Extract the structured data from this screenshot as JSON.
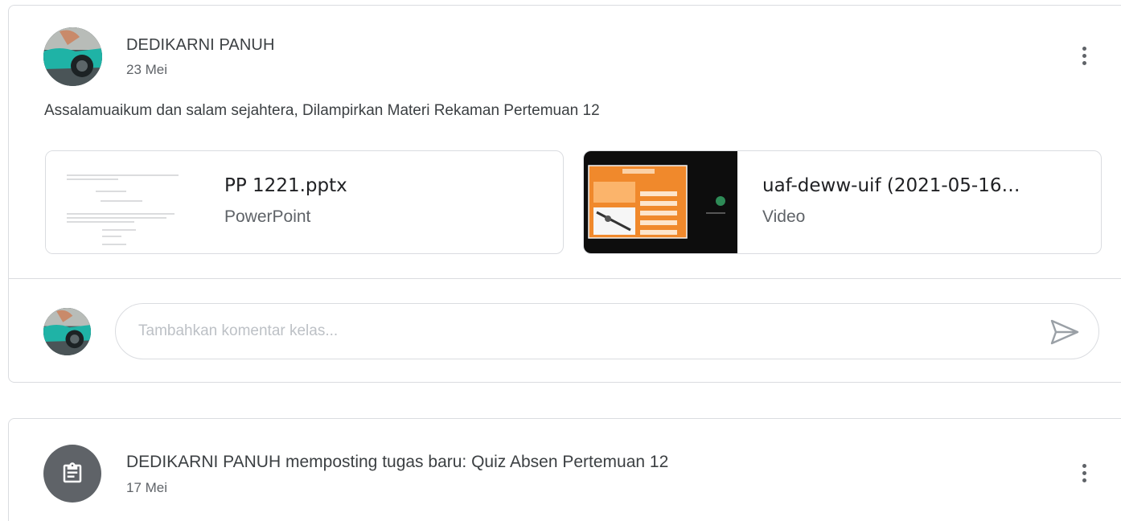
{
  "post": {
    "author": "DEDIKARNI PANUH",
    "date": "23 Mei",
    "body": "Assalamuaikum dan salam sejahtera, Dilampirkan Materi Rekaman Pertemuan 12",
    "attachments": [
      {
        "title": "PP 1221.pptx",
        "type": "PowerPoint",
        "icon": "pptx-thumbnail"
      },
      {
        "title": "uaf-deww-uif (2021-05-16…",
        "type": "Video",
        "icon": "video-thumbnail"
      }
    ],
    "comment": {
      "placeholder": "Tambahkan komentar kelas...",
      "send_icon": "send-icon"
    }
  },
  "assignment": {
    "text": "DEDIKARNI PANUH memposting tugas baru: Quiz Absen Pertemuan 12",
    "date": "17 Mei",
    "icon": "assignment-icon"
  },
  "colors": {
    "border": "#dadce0",
    "secondary_text": "#5f6368",
    "primary_text": "#3c4043",
    "placeholder": "#bdc1c6",
    "icon_bg": "#5f6368",
    "video_orange": "#f0892c"
  }
}
